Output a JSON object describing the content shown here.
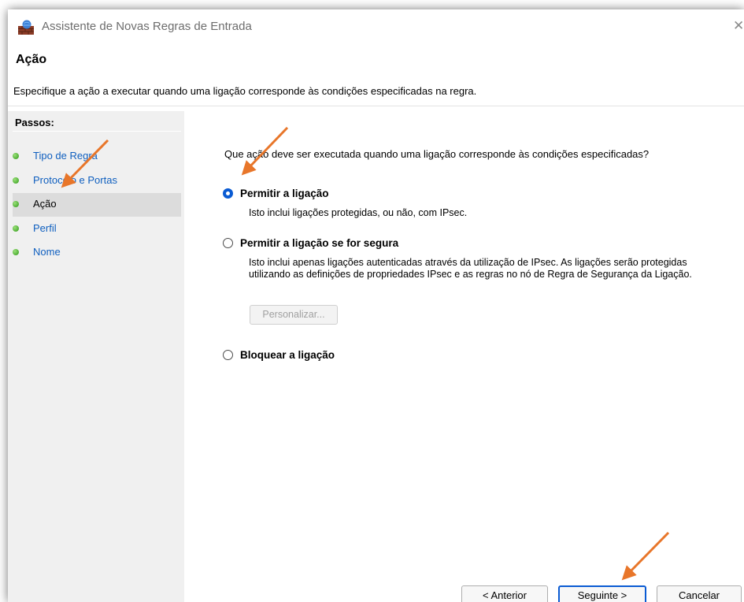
{
  "window": {
    "title": "Assistente de Novas Regras de Entrada",
    "close_glyph": "✕"
  },
  "header": {
    "heading": "Ação",
    "description": "Especifique a ação a executar quando uma ligação corresponde às condições especificadas na regra."
  },
  "sidebar": {
    "steps_label": "Passos:",
    "items": [
      {
        "label": "Tipo de Regra"
      },
      {
        "label": "Protocolo e Portas"
      },
      {
        "label": "Ação",
        "active": true
      },
      {
        "label": "Perfil"
      },
      {
        "label": "Nome"
      }
    ]
  },
  "main": {
    "question": "Que ação deve ser executada quando uma ligação corresponde às condições especificadas?",
    "options": [
      {
        "label": "Permitir a ligação",
        "description": "Isto inclui ligações protegidas, ou não, com IPsec.",
        "selected": true
      },
      {
        "label": "Permitir a ligação se for segura",
        "description": "Isto inclui apenas ligações autenticadas através da utilização de IPsec. As ligações serão protegidas utilizando as definições de propriedades IPsec e as regras no nó de Regra de Segurança da Ligação.",
        "selected": false
      },
      {
        "label": "Bloquear a ligação",
        "description": "",
        "selected": false
      }
    ],
    "customize_button": "Personalizar..."
  },
  "footer": {
    "back": "< Anterior",
    "next": "Seguinte >",
    "cancel": "Cancelar"
  },
  "colors": {
    "accent": "#0a5bd3",
    "link": "#0f5fbf",
    "annotation_arrow": "#e8762a",
    "sidebar_bg": "#f0f0f0"
  },
  "icons": {
    "app": "firewall-wall-icon",
    "step_status": "green-dot-icon"
  }
}
